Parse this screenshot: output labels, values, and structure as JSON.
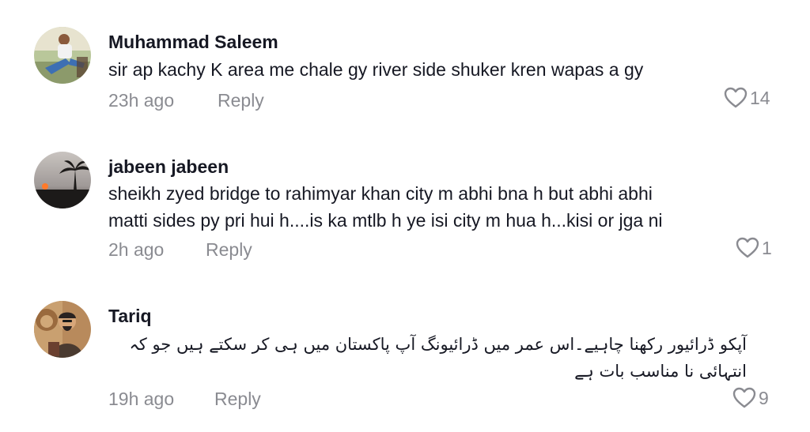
{
  "comments": [
    {
      "username": "Muhammad Saleem",
      "text_lines": [
        "sir ap kachy K area me chale gy river side shuker kren wapas a gy"
      ],
      "time": "23h ago",
      "reply_label": "Reply",
      "likes": "14",
      "avatar_icon": "person-photo-avatar"
    },
    {
      "username": "jabeen jabeen",
      "text_lines": [
        "sheikh zyed bridge to rahimyar khan city m abhi bna h but abhi abhi",
        "matti sides py pri hui h....is ka mtlb h ye isi city m hua h...kisi or jga ni"
      ],
      "time": "2h ago",
      "reply_label": "Reply",
      "likes": "1",
      "avatar_icon": "sunset-palm-avatar"
    },
    {
      "username": "Tariq",
      "text_lines": [
        "آپکو ڈرائیور رکھنا چاہیے۔اس عمر میں ڈرائیونگ آپ پاکستان میں ہی کر سکتے ہیں جو کہ",
        "انتہائی نا مناسب بات ہے"
      ],
      "time": "19h ago",
      "reply_label": "Reply",
      "likes": "9",
      "avatar_icon": "person-lion-avatar"
    }
  ],
  "colors": {
    "text": "#161823",
    "muted": "#8a8b91",
    "background": "#ffffff"
  },
  "icons": {
    "like": "heart-outline-icon"
  }
}
